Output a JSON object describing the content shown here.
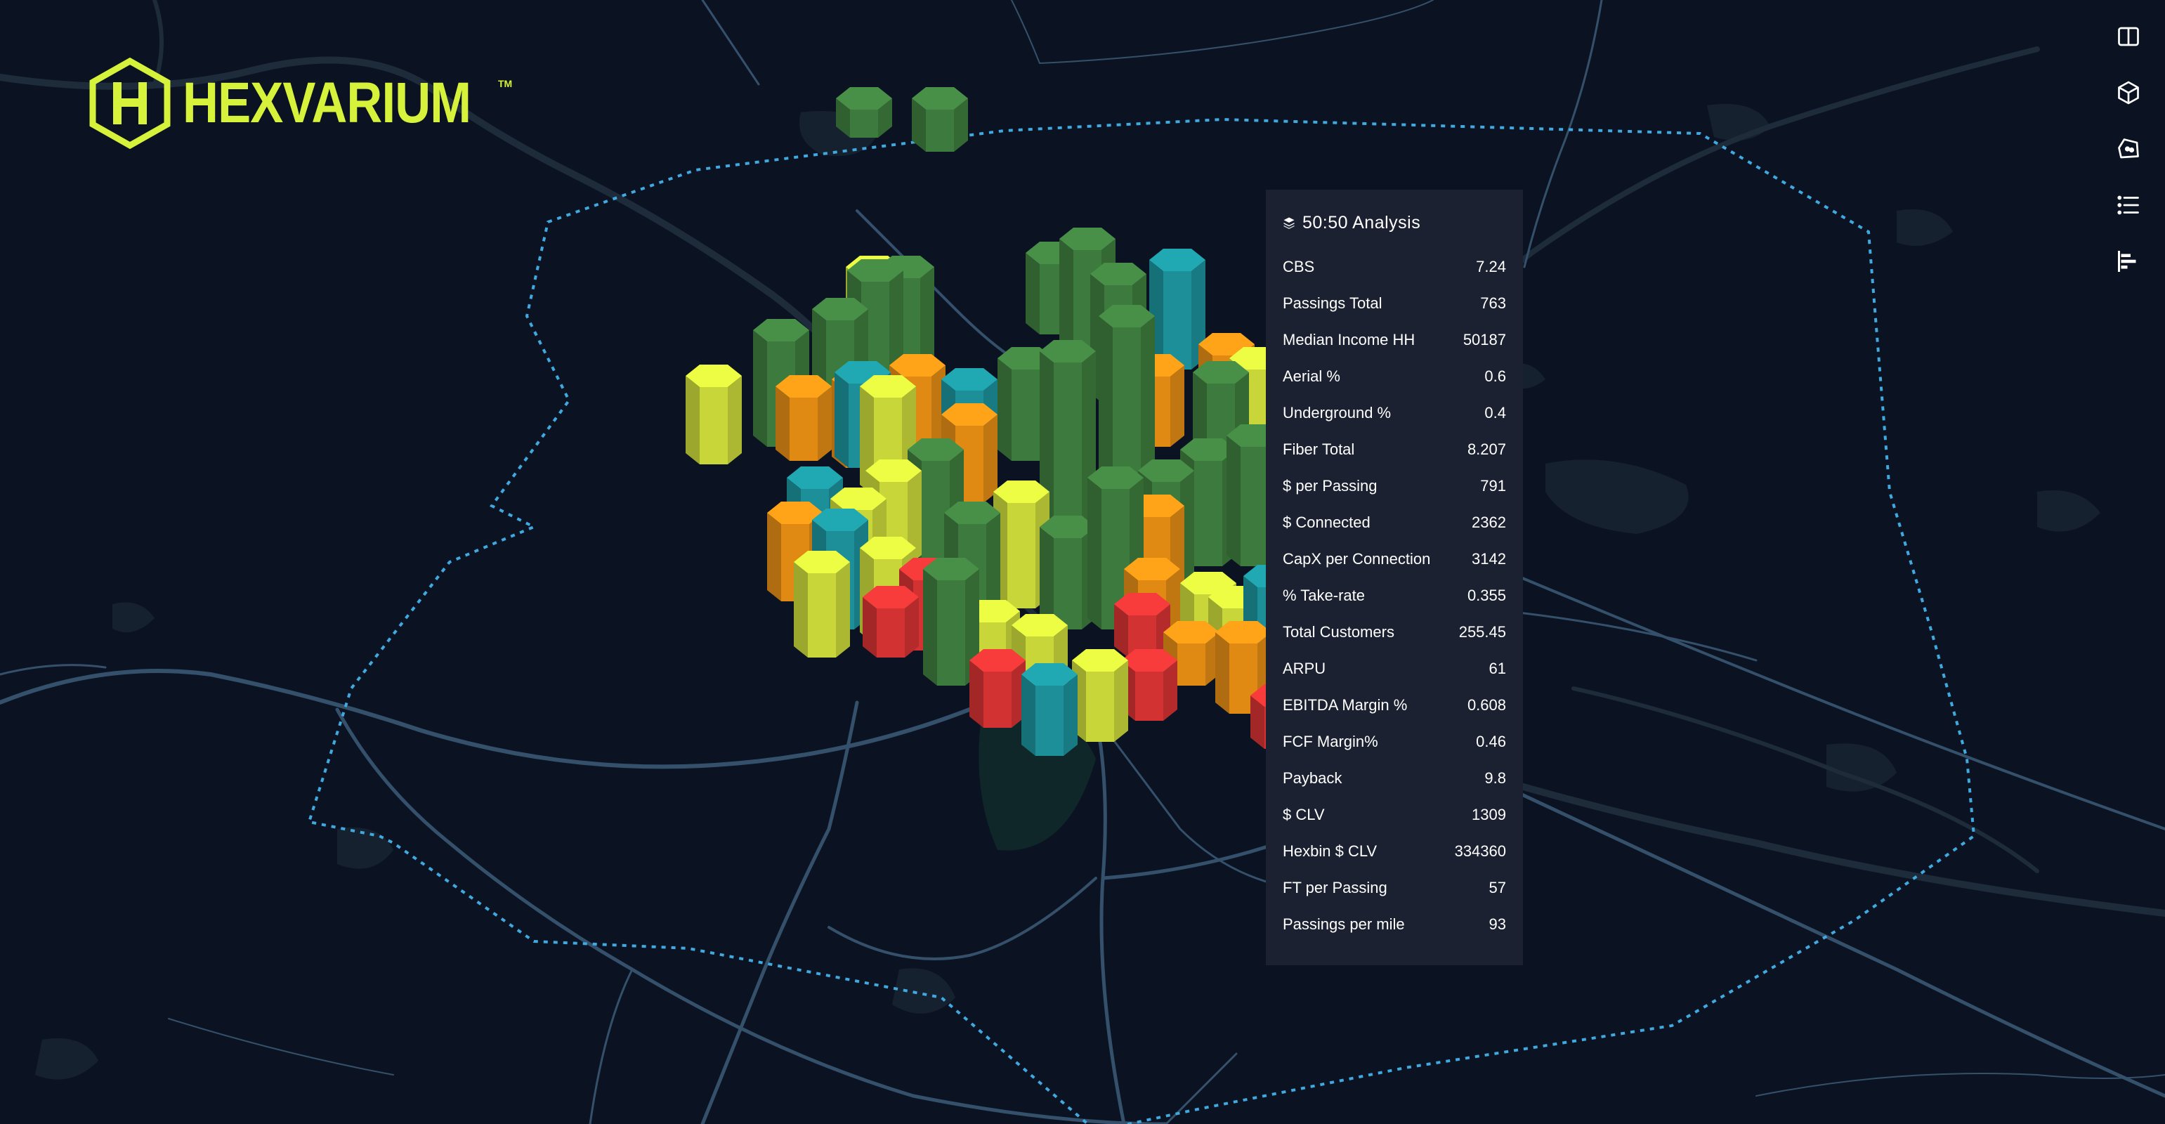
{
  "brand": {
    "logo_letter": "H",
    "name": "HEXVARIUM",
    "trademark": "TM",
    "color": "#d6f23a"
  },
  "toolbar": {
    "items": [
      {
        "icon": "book-open-icon",
        "label": "Book"
      },
      {
        "icon": "cube-3d-icon",
        "label": "3D"
      },
      {
        "icon": "polygon-select-icon",
        "label": "Polygon"
      },
      {
        "icon": "list-icon",
        "label": "List"
      },
      {
        "icon": "bar-chart-horizontal-icon",
        "label": "Chart"
      }
    ]
  },
  "panel": {
    "icon": "layers-icon",
    "title": "50:50 Analysis",
    "metrics": [
      {
        "label": "CBS",
        "value": "7.24"
      },
      {
        "label": "Passings Total",
        "value": "763"
      },
      {
        "label": "Median Income HH",
        "value": "50187"
      },
      {
        "label": "Aerial %",
        "value": "0.6"
      },
      {
        "label": "Underground %",
        "value": "0.4"
      },
      {
        "label": "Fiber Total",
        "value": "8.207"
      },
      {
        "label": "$ per Passing",
        "value": "791"
      },
      {
        "label": "$ Connected",
        "value": "2362"
      },
      {
        "label": "CapX per Connection",
        "value": "3142"
      },
      {
        "label": "% Take-rate",
        "value": "0.355"
      },
      {
        "label": "Total Customers",
        "value": "255.45"
      },
      {
        "label": "ARPU",
        "value": "61"
      },
      {
        "label": "EBITDA Margin %",
        "value": "0.608"
      },
      {
        "label": "FCF Margin%",
        "value": "0.46"
      },
      {
        "label": "Payback",
        "value": "9.8"
      },
      {
        "label": "$ CLV",
        "value": "1309"
      },
      {
        "label": "Hexbin $ CLV",
        "value": "334360"
      },
      {
        "label": "FT per Passing",
        "value": "57"
      },
      {
        "label": "Passings per mile",
        "value": "93"
      }
    ]
  },
  "map": {
    "background": "#0b1322",
    "boundary_color": "#3fa9e0",
    "road_color": "#34506a",
    "hex_colors": {
      "green": "#3d7a3d",
      "yellow": "#c8d63a",
      "orange": "#e08a14",
      "teal": "#1c8f98",
      "red": "#d23232"
    }
  }
}
